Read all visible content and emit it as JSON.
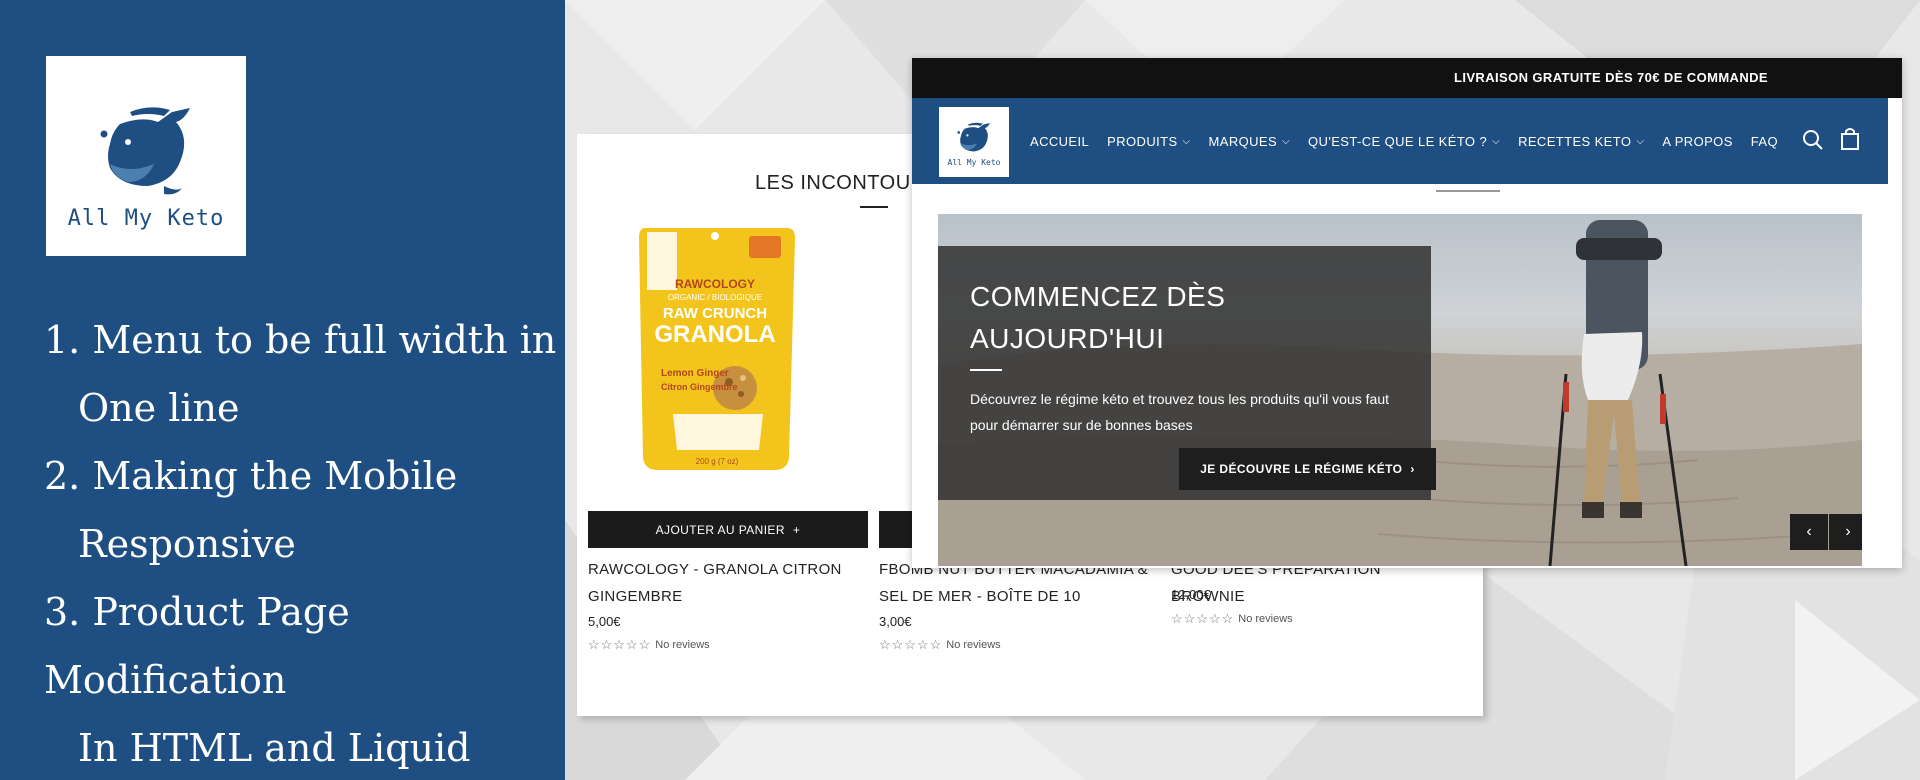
{
  "left_panel": {
    "logo_text": "All My Keto",
    "notes": [
      {
        "first": "1. Menu to be full width in",
        "cont": "One line"
      },
      {
        "first": "2. Making the Mobile",
        "cont": "Responsive"
      },
      {
        "first": "3. Product Page Modification",
        "cont": "In HTML and Liquid"
      }
    ]
  },
  "back_shot": {
    "section_title": "LES INCONTOURNABLES",
    "add_to_cart": "AJOUTER AU PANIER",
    "products": [
      {
        "name": "RAWCOLOGY - GRANOLA CITRON GINGEMBRE",
        "price": "5,00€",
        "reviews": "No reviews"
      },
      {
        "name": "FBOMB NUT BUTTER MACADAMIA & SEL DE MER - BOÎTE DE 10",
        "price": "3,00€",
        "reviews": "No reviews"
      },
      {
        "name": "GOOD DEE'S PRÉPARATION BROWNIE",
        "price": "12,00€",
        "reviews": "No reviews"
      }
    ],
    "package": {
      "brand": "RAWCOLOGY",
      "subtitle": "ORGANIC / BIOLOGIQUE",
      "line1": "RAW CRUNCH",
      "line2": "GRANOLA",
      "flavor_en": "Lemon Ginger",
      "flavor_fr": "Citron Gingembre",
      "weight": "200 g (7 oz)"
    }
  },
  "front_shot": {
    "promo": "LIVRAISON GRATUITE DÈS 70€ DE COMMANDE",
    "logo_text": "All My Keto",
    "nav": [
      {
        "label": "ACCUEIL",
        "has_dropdown": false
      },
      {
        "label": "PRODUITS",
        "has_dropdown": true
      },
      {
        "label": "MARQUES",
        "has_dropdown": true
      },
      {
        "label": "QU'EST-CE QUE LE KÉTO ?",
        "has_dropdown": true
      },
      {
        "label": "RECETTES KETO",
        "has_dropdown": true
      },
      {
        "label": "A PROPOS",
        "has_dropdown": false
      },
      {
        "label": "FAQ",
        "has_dropdown": false
      }
    ],
    "hero": {
      "title_line1": "COMMENCEZ DÈS",
      "title_line2": "AUJOURD'HUI",
      "desc": "Découvrez le régime kéto et trouvez tous les produits qu'il vous faut pour démarrer sur de bonnes bases",
      "button": "JE DÉCOUVRE LE RÉGIME KÉTO"
    },
    "icons": [
      "search-icon",
      "cart-icon",
      "chevron-left-icon",
      "chevron-right-icon"
    ]
  },
  "colors": {
    "brand_blue": "#1f4f82",
    "dark": "#1b1b1b",
    "accent_yellow": "#f3c51c"
  }
}
